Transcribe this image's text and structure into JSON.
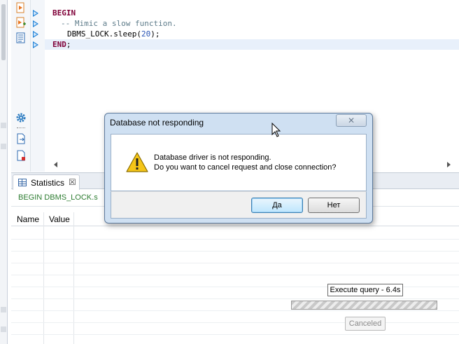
{
  "editor": {
    "lines": [
      {
        "kw": "BEGIN"
      },
      {
        "comment": "-- Mimic a slow function."
      },
      {
        "call_prefix": "DBMS_LOCK.sleep(",
        "number": "20",
        "call_suffix": ");"
      },
      {
        "kw": "END",
        "suffix": ";"
      }
    ]
  },
  "results": {
    "tab_label": "Statistics",
    "tab_close": "☒",
    "query_text": "BEGIN DBMS_LOCK.s",
    "columns": [
      "Name",
      "Value"
    ]
  },
  "progress": {
    "label": "Execute query - 6.4s",
    "cancel_label": "Canceled"
  },
  "dialog": {
    "title": "Database not responding",
    "close_glyph": "✕",
    "message_line1": "Database driver is not responding.",
    "message_line2": "Do you want to cancel request and close connection?",
    "yes_label": "Да",
    "no_label": "Нет"
  },
  "colors": {
    "keyword": "#7f0038",
    "comment": "#5e7c8a",
    "number": "#2b55b5",
    "query_text": "#2e7d32",
    "marker": "#1b7fd6",
    "dialog_frame": "#cfe0f2"
  },
  "icons": {
    "toolbar": [
      "execute-script-icon",
      "execute-script-new-tab-icon",
      "execution-plan-icon",
      "settings-gear-icon",
      "export-icon",
      "load-file-icon"
    ],
    "warning": "warning-triangle-icon",
    "statistics": "statistics-table-icon"
  }
}
